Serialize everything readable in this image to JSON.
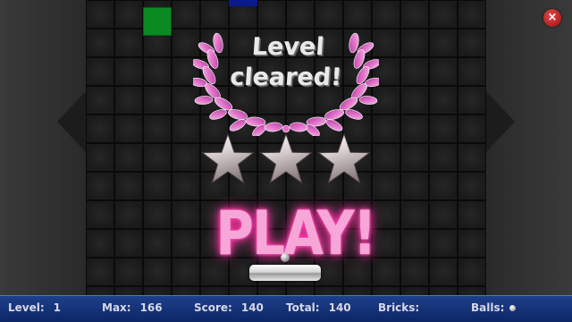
{
  "overlay": {
    "title_line1": "Level",
    "title_line2": "cleared!",
    "stars_earned": 3,
    "stars_total": 3,
    "play_label": "PLAY!"
  },
  "status_bar": {
    "level_label": "Level:",
    "level_value": "1",
    "max_label": "Max:",
    "max_value": "166",
    "score_label": "Score:",
    "score_value": "140",
    "total_label": "Total:",
    "total_value": "140",
    "bricks_label": "Bricks:",
    "bricks_value": "",
    "balls_label": "Balls:",
    "balls_count": 1
  },
  "colors": {
    "wreath": "#e070c8",
    "play_glow": "#ff3fae",
    "status_bar": "#1d3f8a",
    "brick_green": "#0b8a22",
    "brick_blue": "#0a1a8a",
    "close_button": "#c42a2a"
  },
  "icons": {
    "close": "close-icon",
    "star": "star-icon",
    "ball": "ball-icon"
  }
}
